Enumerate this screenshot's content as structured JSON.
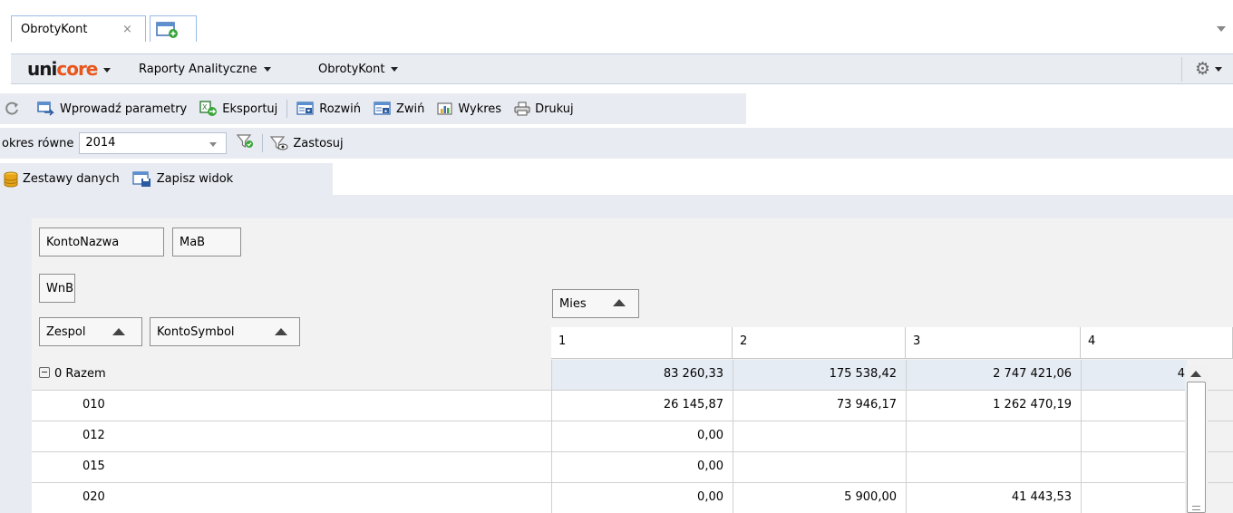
{
  "tabs": {
    "active_label": "ObrotyKont",
    "close_glyph": "×"
  },
  "brandbar": {
    "logo_part1": "uni",
    "logo_part2": "core",
    "menus": [
      "Raporty Analityczne",
      "ObrotyKont"
    ]
  },
  "toolbar": {
    "enter_params": "Wprowadź parametry",
    "export": "Eksportuj",
    "expand": "Rozwiń",
    "collapse": "Zwiń",
    "chart": "Wykres",
    "print": "Drukuj"
  },
  "filter": {
    "label": "okres równe",
    "value": "2014",
    "apply": "Zastosuj"
  },
  "datasets": {
    "datasets_label": "Zestawy danych",
    "save_view_label": "Zapisz widok"
  },
  "pivot": {
    "filter_fields": [
      "KontoNazwa",
      "MaB",
      "WnB"
    ],
    "row_fields": [
      "Zespol",
      "KontoSymbol"
    ],
    "column_field": "Mies",
    "columns": [
      "1",
      "2",
      "3",
      "4"
    ],
    "rows": [
      {
        "label": "0 Razem",
        "values": [
          "83 260,33",
          "175 538,42",
          "2 747 421,06",
          "4"
        ]
      },
      {
        "label": "010",
        "values": [
          "26 145,87",
          "73 946,17",
          "1 262 470,19",
          ""
        ]
      },
      {
        "label": "012",
        "values": [
          "0,00",
          "",
          "",
          ""
        ]
      },
      {
        "label": "015",
        "values": [
          "0,00",
          "",
          "",
          ""
        ]
      },
      {
        "label": "020",
        "values": [
          "0,00",
          "5 900,00",
          "41 443,53",
          ""
        ]
      }
    ]
  },
  "colors": {
    "brand_orange": "#e8561c",
    "toolbar_bg": "#e8ebf1",
    "tab_border": "#99bbe8",
    "total_cell_bg": "#e6ecf4"
  }
}
